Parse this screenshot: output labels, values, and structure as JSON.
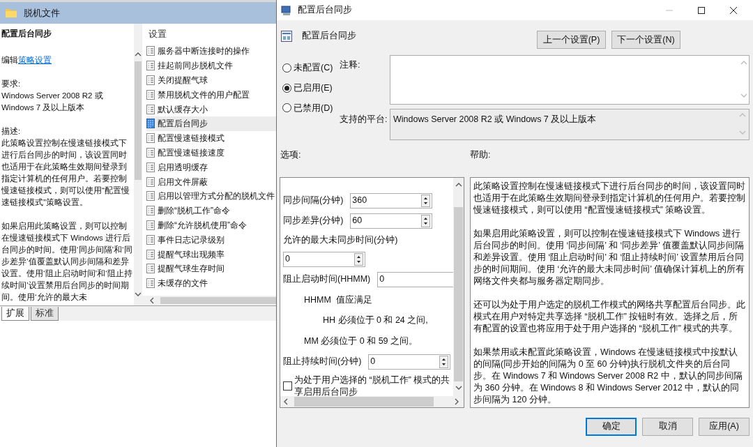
{
  "background_window": {
    "title": "脱机文件",
    "detail": {
      "heading": "配置后台同步",
      "edit_prefix": "编辑",
      "edit_link": "策略设置",
      "requirements_label": "要求:",
      "requirements": "Windows Server 2008 R2 或 Windows 7 及以上版本",
      "description_label": "描述:",
      "description": [
        "此策略设置控制在慢速链接模式下进行后台同步的时间，该设置同时也适用于在此策略生效期间登录到指定计算机的任何用户。若要控制慢速链接模式，则可以使用“配置慢速链接模式”策略设置。",
        "如果启用此策略设置，则可以控制在慢速链接模式下 Windows 进行后台同步的时间。使用‘同步间隔’和‘同步差异’值覆盖默认同步间隔和差异设置。使用‘阻止启动时间’和‘阻止持续时间’设置禁用后台同步的时间期间。使用‘允许的最大未"
      ]
    },
    "list": {
      "column": "设置",
      "items": [
        {
          "label": "服务器中断连接时的操作",
          "selected": false
        },
        {
          "label": "挂起前同步脱机文件",
          "selected": false
        },
        {
          "label": "关闭提醒气球",
          "selected": false
        },
        {
          "label": "禁用脱机文件的用户配置",
          "selected": false
        },
        {
          "label": "默认缓存大小",
          "selected": false
        },
        {
          "label": "配置后台同步",
          "selected": true
        },
        {
          "label": "配置慢速链接模式",
          "selected": false
        },
        {
          "label": "配置慢速链接速度",
          "selected": false
        },
        {
          "label": "启用透明缓存",
          "selected": false
        },
        {
          "label": "启用文件屏蔽",
          "selected": false
        },
        {
          "label": "启用以管理方式分配的脱机文件",
          "selected": false
        },
        {
          "label": "删除“脱机工作”命令",
          "selected": false
        },
        {
          "label": "删除“允许脱机使用”命令",
          "selected": false
        },
        {
          "label": "事件日志记录级别",
          "selected": false
        },
        {
          "label": "提醒气球出现频率",
          "selected": false
        },
        {
          "label": "提醒气球生存时间",
          "selected": false
        },
        {
          "label": "未缓存的文件",
          "selected": false
        }
      ]
    },
    "tabs": [
      {
        "label": "扩展",
        "selected": true
      },
      {
        "label": "标准",
        "selected": false
      }
    ]
  },
  "dialog": {
    "title": "配置后台同步",
    "setting_name": "配置后台同步",
    "nav_buttons": [
      "上一个设置(P)",
      "下一个设置(N)"
    ],
    "states": [
      {
        "label": "未配置(C)",
        "selected": false
      },
      {
        "label": "已启用(E)",
        "selected": true
      },
      {
        "label": "已禁用(D)",
        "selected": false
      }
    ],
    "comment_label": "注释:",
    "platform_label": "支持的平台:",
    "platform": "Windows Server 2008 R2 或 Windows 7 及以上版本",
    "options_label": "选项:",
    "help_label": "帮助:",
    "options": [
      {
        "kind": "inline",
        "label": "同步间隔(分钟)",
        "value": "360"
      },
      {
        "kind": "inline",
        "label": "同步差异(分钟)",
        "value": "60"
      },
      {
        "kind": "stacked",
        "label": "允许的最大未同步时间(分钟)",
        "value": "0"
      },
      {
        "kind": "inline_wide",
        "label": "阻止启动时间(HHMM)",
        "value": "0"
      },
      {
        "kind": "note",
        "text": "HHMM  值应满足"
      },
      {
        "kind": "note_deep",
        "text": "HH 必须位于 0 和 24 之间,"
      },
      {
        "kind": "note",
        "text": "MM 必须位于 0 和 59 之间。"
      },
      {
        "kind": "inline",
        "label": "阻止持续时间(分钟)",
        "value": "0"
      },
      {
        "kind": "checkbox",
        "label": "为处于用户选择的 “脱机工作” 模式的共享启用后台同步",
        "checked": false
      }
    ],
    "help": [
      "此策略设置控制在慢速链接模式下进行后台同步的时间，该设置同时也适用于在此策略生效期间登录到指定计算机的任何用户。若要控制慢速链接模式，则可以使用 “配置慢速链接模式” 策略设置。",
      "如果启用此策略设置，则可以控制在慢速链接模式下 Windows 进行后台同步的时间。使用 ‘同步间隔’ 和 ‘同步差异’ 值覆盖默认同步间隔和差异设置。使用 ‘阻止启动时间’ 和 ‘阻止持续时间’ 设置禁用后台同步的时间期间。使用 ‘允许的最大未同步时间’ 值确保计算机上的所有网络文件夹都与服务器定期同步。",
      "还可以为处于用户选定的脱机工作模式的网络共享配置后台同步。此模式在用户对特定共享选择 “脱机工作” 按钮时有效。选择之后，所有配置的设置也将应用于处于用户选择的 “脱机工作” 模式的共享。",
      "如果禁用或未配置此策略设置，Windows 在慢速链接模式中按默认的间隔(同步开始的间隔为 0 至 60 分钟)执行脱机文件夹的后台同步。在 Windows 7 和 Windows Server 2008 R2 中，默认的同步间隔为 360 分钟。在 Windows 8 和 Windows Server 2012 中，默认的同步间隔为 120 分钟。"
    ],
    "buttons": [
      {
        "label": "确定",
        "default": true
      },
      {
        "label": "取消",
        "default": false
      },
      {
        "label": "应用(A)",
        "default": false
      }
    ]
  }
}
